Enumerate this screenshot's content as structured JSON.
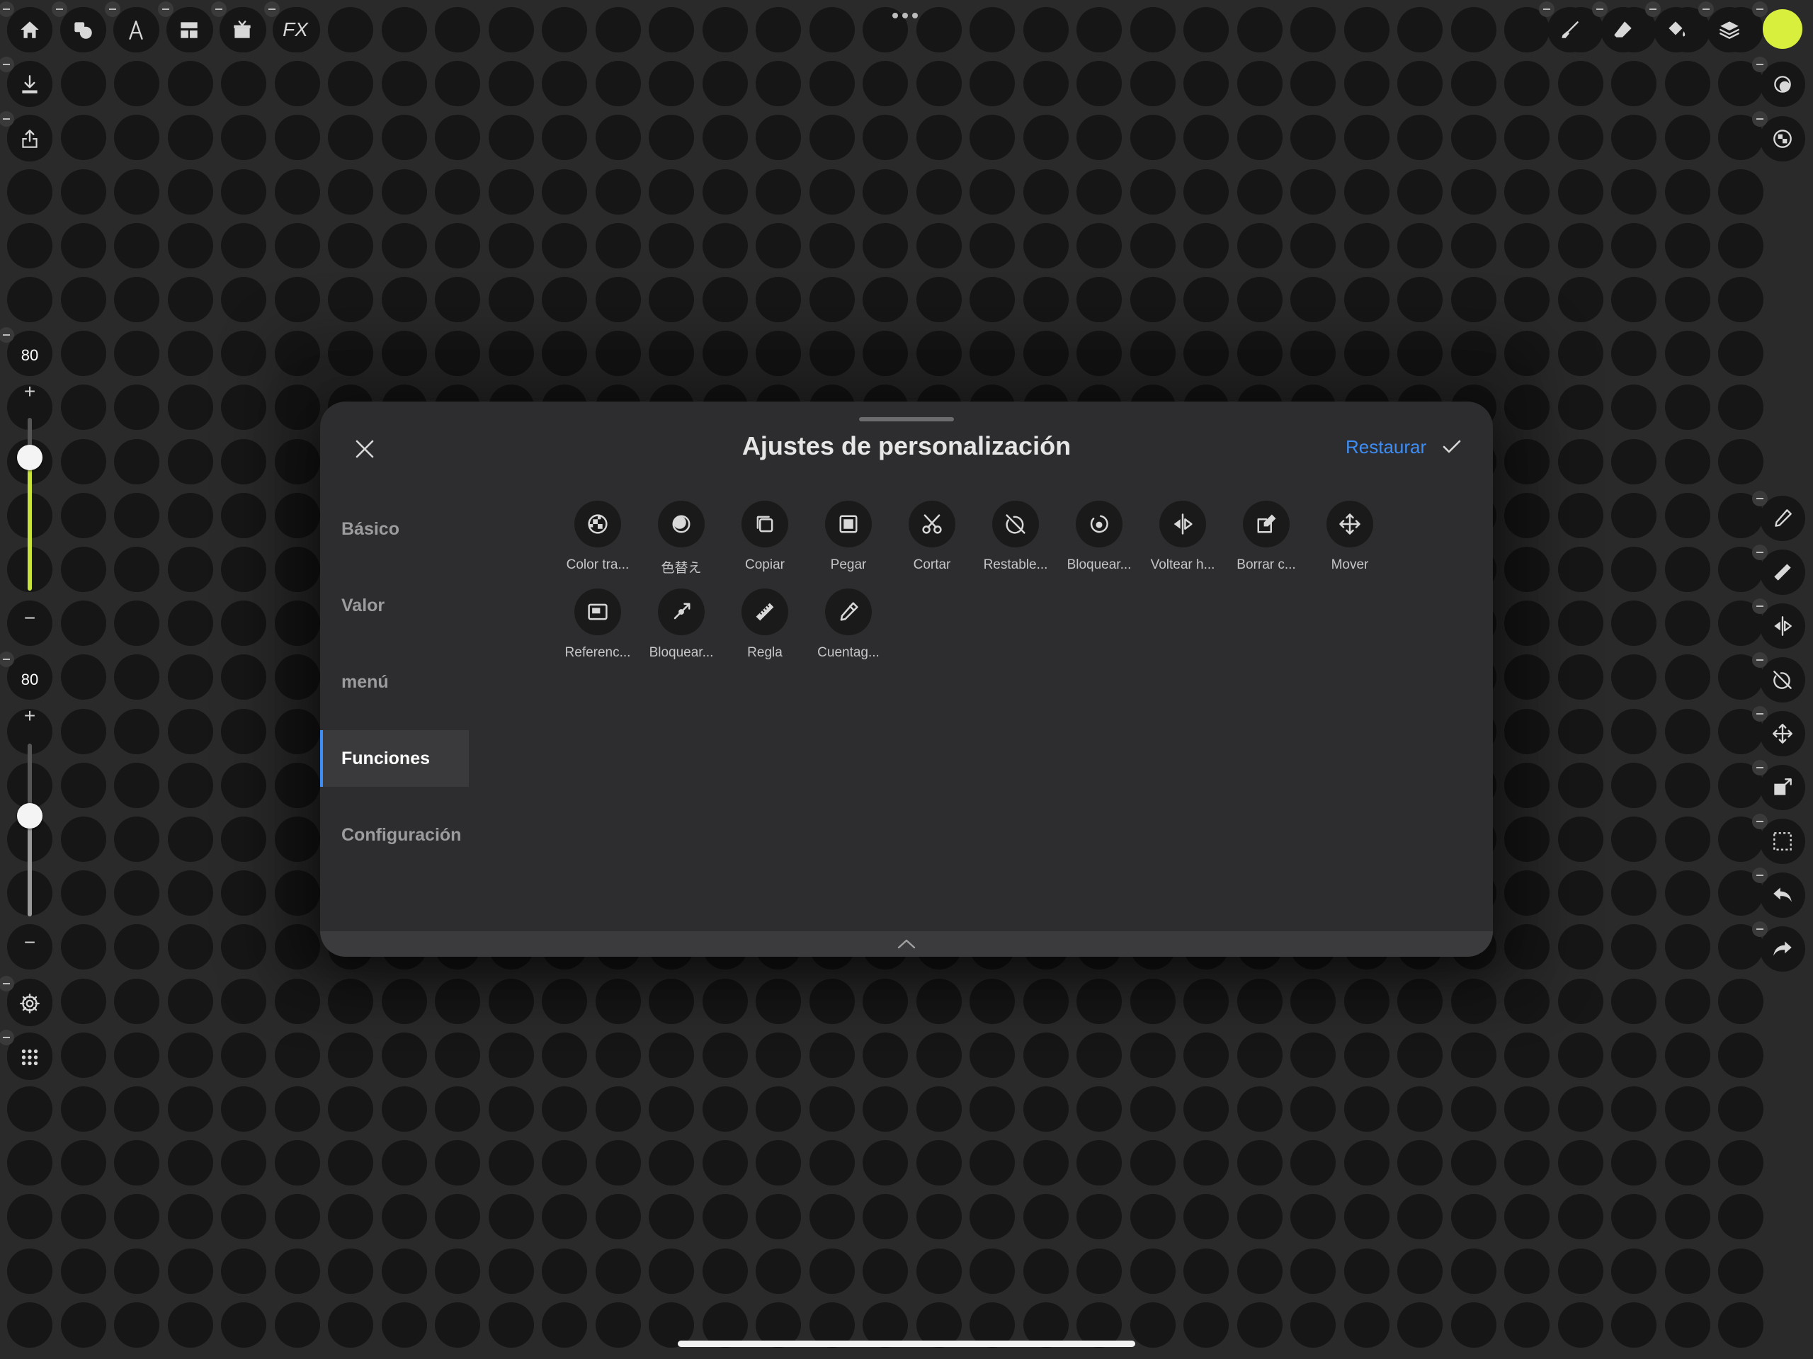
{
  "top_toolbar_left": [
    {
      "name": "home-icon"
    },
    {
      "name": "shapes-icon"
    },
    {
      "name": "text-icon"
    },
    {
      "name": "layout-icon"
    },
    {
      "name": "gift-icon"
    },
    {
      "name": "fx-icon",
      "label": "FX"
    }
  ],
  "top_toolbar_right": [
    {
      "name": "brush-icon"
    },
    {
      "name": "eraser-icon"
    },
    {
      "name": "bucket-icon"
    },
    {
      "name": "layers-icon"
    }
  ],
  "colors": {
    "current_color": "#d9ef3e",
    "accent": "#3d8df5"
  },
  "sliders": {
    "brush_size": {
      "value": "80",
      "level": 0.77
    },
    "opacity": {
      "value": "80",
      "level": 0.58
    }
  },
  "modal": {
    "title": "Ajustes de personalización",
    "restore_label": "Restaurar",
    "nav": [
      {
        "label": "Básico",
        "active": false
      },
      {
        "label": "Valor",
        "active": false
      },
      {
        "label": "menú",
        "active": false
      },
      {
        "label": "Funciones",
        "active": true
      },
      {
        "label": "Configuración",
        "active": false
      }
    ],
    "features": [
      {
        "label": "Color tra...",
        "icon": "transparency-icon"
      },
      {
        "label": "色替え",
        "icon": "color-swap-icon"
      },
      {
        "label": "Copiar",
        "icon": "copy-icon"
      },
      {
        "label": "Pegar",
        "icon": "paste-icon"
      },
      {
        "label": "Cortar",
        "icon": "scissors-icon"
      },
      {
        "label": "Restable...",
        "icon": "reset-rotation-icon"
      },
      {
        "label": "Bloquear...",
        "icon": "lock-rotation-icon"
      },
      {
        "label": "Voltear h...",
        "icon": "flip-horizontal-icon"
      },
      {
        "label": "Borrar c...",
        "icon": "clear-layer-icon"
      },
      {
        "label": "Mover",
        "icon": "move-icon"
      },
      {
        "label": "Referenc...",
        "icon": "reference-window-icon"
      },
      {
        "label": "Bloquear...",
        "icon": "lock-pen-icon"
      },
      {
        "label": "Regla",
        "icon": "ruler-icon"
      },
      {
        "label": "Cuentag...",
        "icon": "eyedropper-icon"
      }
    ]
  }
}
